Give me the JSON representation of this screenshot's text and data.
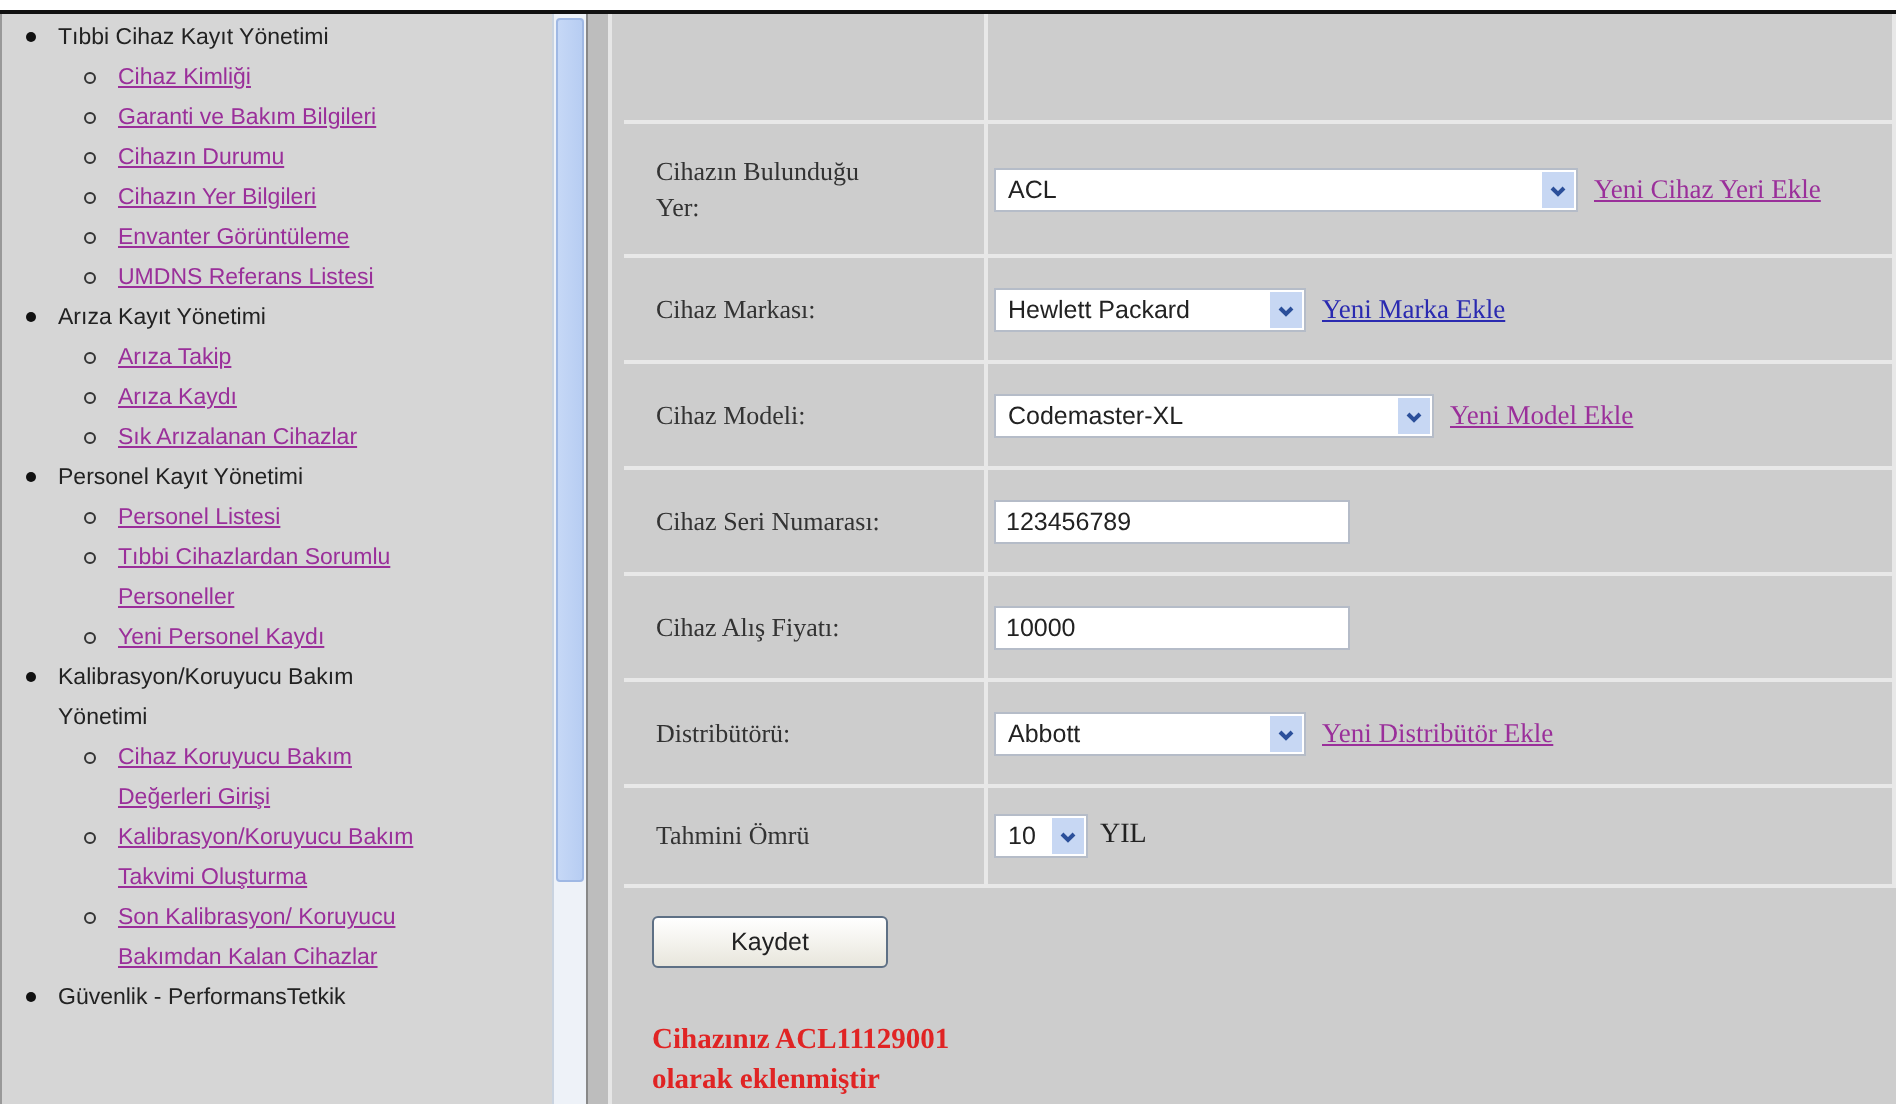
{
  "sidebar": {
    "sections": [
      {
        "label": "Tıbbi Cihaz Kayıt Yönetimi",
        "children": [
          {
            "label": "Cihaz Kimliği"
          },
          {
            "label": "Garanti ve Bakım Bilgileri"
          },
          {
            "label": "Cihazın Durumu"
          },
          {
            "label": "Cihazın Yer Bilgileri"
          },
          {
            "label": "Envanter Görüntüleme"
          },
          {
            "label": "UMDNS Referans Listesi"
          }
        ]
      },
      {
        "label": "Arıza Kayıt Yönetimi",
        "children": [
          {
            "label": "Arıza Takip"
          },
          {
            "label": "Arıza Kaydı"
          },
          {
            "label": "Sık Arızalanan Cihazlar"
          }
        ]
      },
      {
        "label": "Personel Kayıt Yönetimi",
        "children": [
          {
            "label": "Personel Listesi"
          },
          {
            "label": "Tıbbi Cihazlardan Sorumlu Personeller"
          },
          {
            "label": "Yeni Personel Kaydı"
          }
        ]
      },
      {
        "label": "Kalibrasyon/Koruyucu Bakım Yönetimi",
        "children": [
          {
            "label": "Cihaz Koruyucu Bakım Değerleri Girişi"
          },
          {
            "label": "Kalibrasyon/Koruyucu Bakım Takvimi Oluşturma"
          },
          {
            "label": "Son Kalibrasyon/ Koruyucu Bakımdan Kalan Cihazlar"
          }
        ]
      },
      {
        "label": "Güvenlik - PerformansTetkik"
      }
    ]
  },
  "form": {
    "rows": [
      {
        "label": "Cihazın Bulunduğu Yer:",
        "kind": "select",
        "value": "ACL",
        "link": {
          "label": "Yeni Cihaz Yeri Ekle",
          "visited": true
        }
      },
      {
        "label": "Cihaz Markası:",
        "kind": "select",
        "value": "Hewlett Packard",
        "link": {
          "label": "Yeni Marka Ekle",
          "visited": false
        }
      },
      {
        "label": "Cihaz Modeli:",
        "kind": "select",
        "value": "Codemaster-XL",
        "link": {
          "label": "Yeni Model Ekle",
          "visited": true
        }
      },
      {
        "label": "Cihaz Seri Numarası:",
        "kind": "text",
        "value": "123456789"
      },
      {
        "label": "Cihaz Alış Fiyatı:",
        "kind": "text",
        "value": "10000"
      },
      {
        "label": "Distribütörü:",
        "kind": "select",
        "value": "Abbott",
        "link": {
          "label": "Yeni Distribütör Ekle",
          "visited": true
        }
      },
      {
        "label": "Tahmini Ömrü",
        "kind": "select",
        "value": "10",
        "unit": "YIL"
      }
    ],
    "save_button": "Kaydet",
    "message": "Cihazınız ACL11129001 olarak eklenmiştir"
  }
}
